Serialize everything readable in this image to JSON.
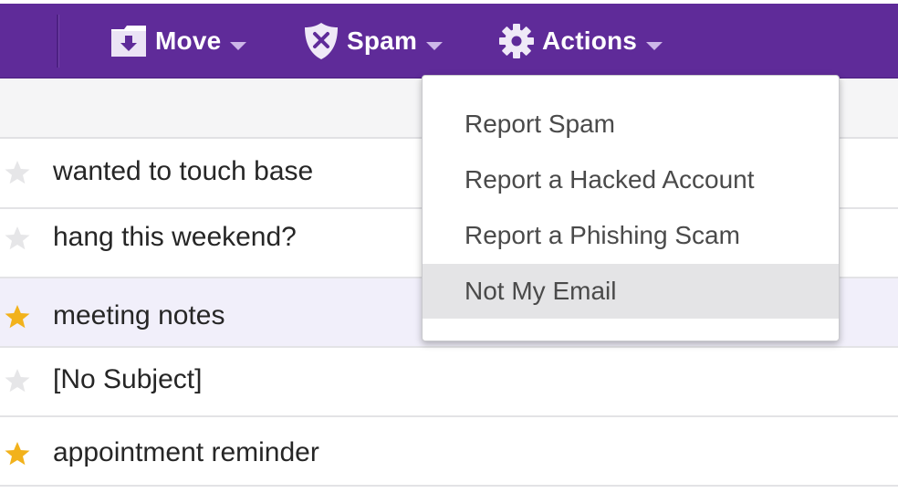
{
  "colors": {
    "toolbar_bg": "#5f2b99",
    "star_on": "#f2b21c",
    "star_off": "#e6e6e8",
    "selected_row": "#f1effa",
    "menu_hover": "#e4e4e6"
  },
  "toolbar": {
    "move": {
      "label": "Move",
      "icon": "folder-move-icon"
    },
    "spam": {
      "label": "Spam",
      "icon": "shield-x-icon"
    },
    "actions": {
      "label": "Actions",
      "icon": "gear-icon"
    }
  },
  "spam_menu": {
    "items": [
      {
        "label": "Report Spam",
        "highlighted": false
      },
      {
        "label": "Report a Hacked Account",
        "highlighted": false
      },
      {
        "label": "Report a Phishing Scam",
        "highlighted": false
      },
      {
        "label": "Not My Email",
        "highlighted": true
      }
    ]
  },
  "messages": [
    {
      "subject": "wanted to touch base",
      "starred": false,
      "selected": false
    },
    {
      "subject": "hang this weekend?",
      "starred": false,
      "selected": false
    },
    {
      "subject": "meeting notes",
      "starred": true,
      "selected": true
    },
    {
      "subject": "[No Subject]",
      "starred": false,
      "selected": false
    },
    {
      "subject": "appointment reminder",
      "starred": true,
      "selected": false
    }
  ]
}
